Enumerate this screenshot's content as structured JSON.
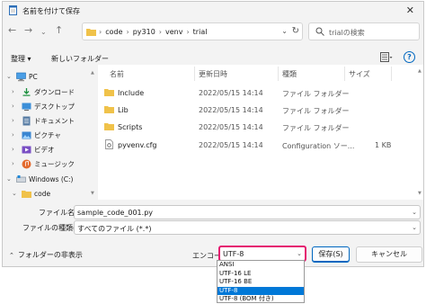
{
  "window": {
    "title": "名前を付けて保存"
  },
  "nav": {
    "path": [
      "code",
      "py310",
      "venv",
      "trial"
    ],
    "search_placeholder": "trialの検索"
  },
  "toolbar": {
    "organize_label": "整理 ▾",
    "new_folder_label": "新しいフォルダー"
  },
  "navpane": {
    "items": [
      {
        "label": "PC",
        "icon": "pc-icon"
      },
      {
        "label": "ダウンロード",
        "icon": "download-icon"
      },
      {
        "label": "デスクトップ",
        "icon": "desktop-icon"
      },
      {
        "label": "ドキュメント",
        "icon": "documents-icon"
      },
      {
        "label": "ピクチャ",
        "icon": "pictures-icon"
      },
      {
        "label": "ビデオ",
        "icon": "videos-icon"
      },
      {
        "label": "ミュージック",
        "icon": "music-icon"
      },
      {
        "label": "Windows (C:)",
        "icon": "drive-icon"
      },
      {
        "label": "code",
        "icon": "folder-icon"
      }
    ]
  },
  "filelist": {
    "columns": [
      "名前",
      "更新日時",
      "種類",
      "サイズ"
    ],
    "rows": [
      {
        "name": "Include",
        "date": "2022/05/15 14:14",
        "type": "ファイル フォルダー",
        "size": "",
        "icon": "folder-icon"
      },
      {
        "name": "Lib",
        "date": "2022/05/15 14:14",
        "type": "ファイル フォルダー",
        "size": "",
        "icon": "folder-icon"
      },
      {
        "name": "Scripts",
        "date": "2022/05/15 14:14",
        "type": "ファイル フォルダー",
        "size": "",
        "icon": "folder-icon"
      },
      {
        "name": "pyvenv.cfg",
        "date": "2022/05/15 14:14",
        "type": "Configuration ソー...",
        "size": "1 KB",
        "icon": "config-file-icon"
      }
    ]
  },
  "form": {
    "filename_label": "ファイル名(N):",
    "filename_value": "sample_code_001.py",
    "filetype_label": "ファイルの種類(T):",
    "filetype_value": "すべてのファイル (*.*)",
    "hide_folders_label": "フォルダーの非表示",
    "encoding_label": "エンコード:",
    "encoding_value": "UTF-8",
    "save_label": "保存(S)",
    "cancel_label": "キャンセル"
  },
  "encoding_options": [
    "ANSI",
    "UTF-16 LE",
    "UTF-16 BE",
    "UTF-8",
    "UTF-8 (BOM 付き)"
  ],
  "encoding_selected_index": 3,
  "colors": {
    "accent": "#0078d7",
    "highlight_border": "#e5176f",
    "folder": "#f0c24a"
  }
}
